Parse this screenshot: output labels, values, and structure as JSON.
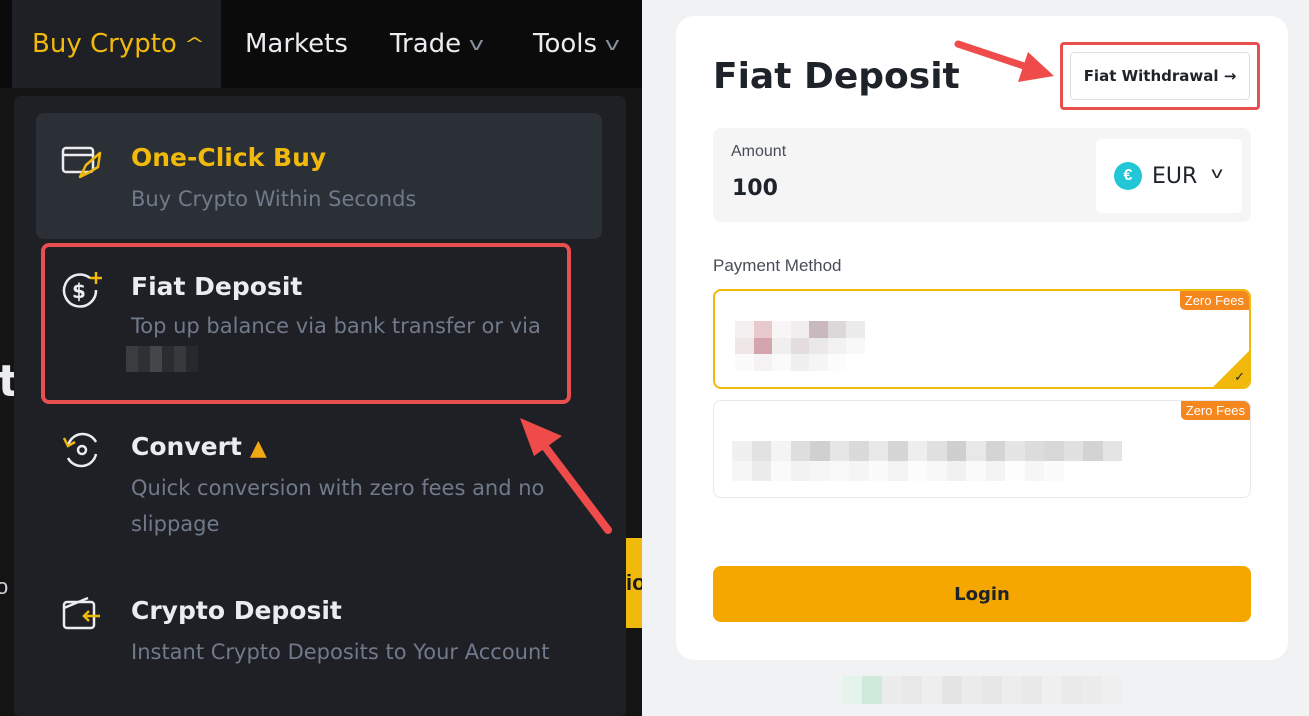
{
  "nav": {
    "buy_crypto": "Buy Crypto",
    "markets": "Markets",
    "trade": "Trade",
    "tools": "Tools"
  },
  "menu": {
    "items": [
      {
        "title": "One-Click Buy",
        "desc": "Buy Crypto Within Seconds",
        "icon": "rocket-card-icon"
      },
      {
        "title": "Fiat Deposit",
        "desc": "Top up balance via bank transfer or via",
        "icon": "dollar-plus-icon"
      },
      {
        "title": "Convert",
        "desc": "Quick conversion with zero fees and no slippage",
        "icon": "convert-icon",
        "badge_icon": "fire-icon"
      },
      {
        "title": "Crypto Deposit",
        "desc": "Instant Crypto Deposits to Your Account",
        "icon": "wallet-arrow-icon"
      }
    ]
  },
  "background": {
    "partial_letter": "t",
    "partial_text": "o",
    "partial_button_text": "io"
  },
  "deposit": {
    "title": "Fiat Deposit",
    "withdraw_button": "Fiat Withdrawal →",
    "amount_label": "Amount",
    "amount_value": "100",
    "currency": "EUR",
    "currency_symbol": "€",
    "payment_method_label": "Payment Method",
    "payment_options": [
      {
        "badge": "Zero Fees",
        "selected": true
      },
      {
        "badge": "Zero Fees",
        "selected": false
      }
    ],
    "login_button": "Login"
  },
  "colors": {
    "accent": "#f0b90b",
    "highlight": "#e84f4f",
    "login": "#f5a700"
  }
}
